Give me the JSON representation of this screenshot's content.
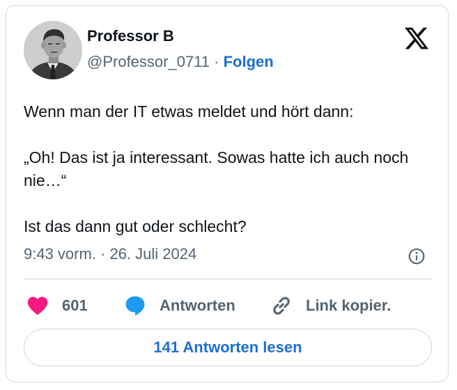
{
  "author": {
    "name": "Professor B",
    "handle": "@Professor_0711",
    "separator": "·",
    "follow_label": "Folgen"
  },
  "tweet": {
    "paragraphs": [
      "Wenn man der IT etwas meldet und hört dann:",
      "„Oh! Das ist ja interessant. Sowas hatte ich auch noch nie…“",
      "Ist das dann gut oder schlecht?"
    ],
    "timestamp": "9:43 vorm. · 26. Juli 2024"
  },
  "actions": {
    "like_count": "601",
    "reply_label": "Antworten",
    "copy_link_label": "Link kopier."
  },
  "read_replies_label": "141 Antworten lesen",
  "icons": {
    "logo": "x-logo-icon",
    "info": "info-icon",
    "like": "heart-icon",
    "reply": "speech-bubble-icon",
    "link": "link-icon"
  },
  "colors": {
    "accent": "#1d6fd1",
    "like": "#f91880",
    "muted": "#536471",
    "text": "#0f1419",
    "border": "#cfd9de"
  }
}
